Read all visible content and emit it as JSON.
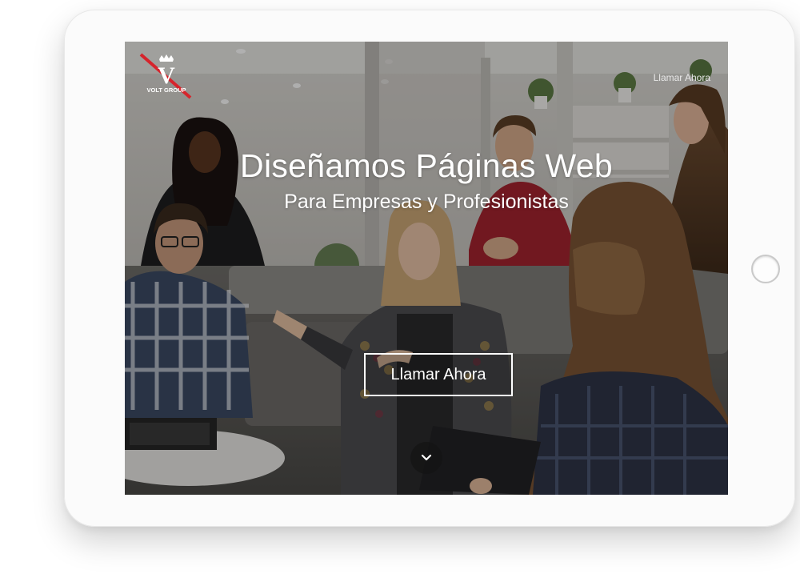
{
  "brand": {
    "name": "VOLT GROUP",
    "mark": "V"
  },
  "nav": {
    "call_link": "Llamar Ahora"
  },
  "hero": {
    "title": "Diseñamos Páginas Web",
    "subtitle": "Para Empresas y Profesionistas",
    "cta_label": "Llamar Ahora"
  },
  "icons": {
    "scroll": "chevron-down-icon",
    "crown": "crown-icon"
  },
  "colors": {
    "accent_red": "#d6242c",
    "text": "#ffffff",
    "frame": "#fbfbfb"
  }
}
